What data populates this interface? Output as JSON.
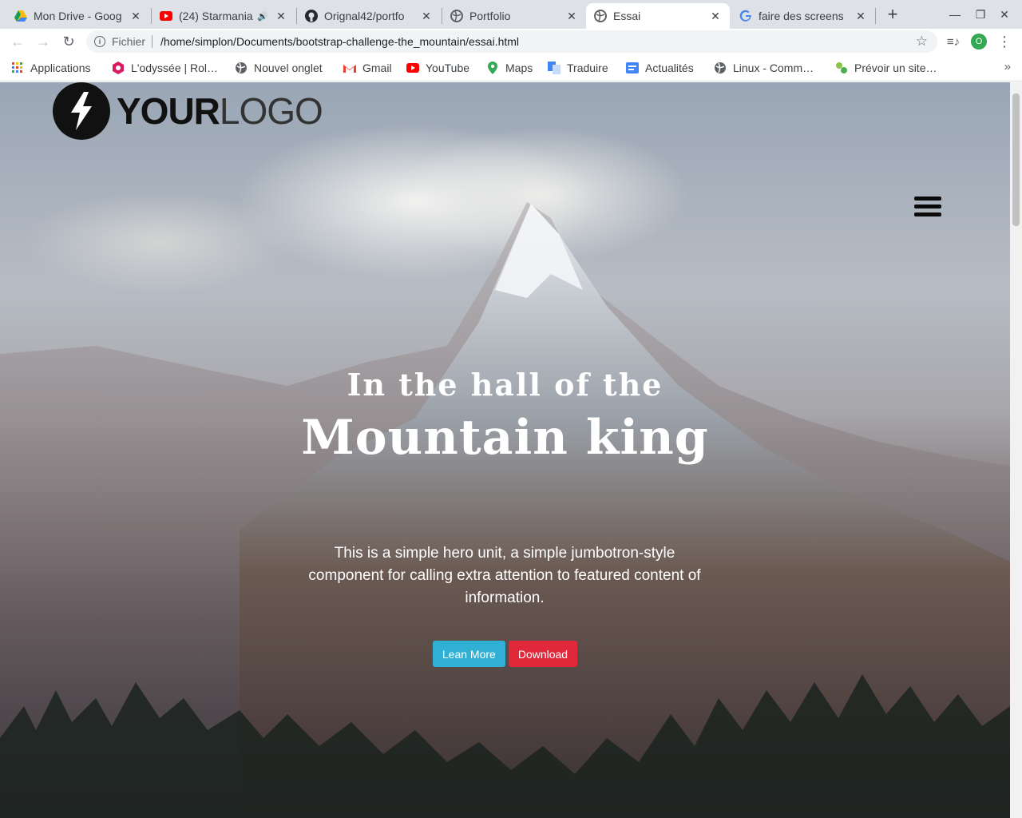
{
  "browser": {
    "tabs": [
      {
        "title": "Mon Drive - Goog",
        "icon": "drive-icon"
      },
      {
        "title": "(24) Starmania",
        "icon": "youtube-icon"
      },
      {
        "title": "Orignal42/portfo",
        "icon": "github-icon"
      },
      {
        "title": "Portfolio",
        "icon": "globe-icon"
      },
      {
        "title": "Essai",
        "icon": "globe-icon"
      },
      {
        "title": "faire des screens",
        "icon": "google-icon"
      }
    ],
    "url_scheme": "Fichier",
    "url": "/home/simplon/Documents/bootstrap-challenge-the_mountain/essai.html",
    "profile_initial": "O"
  },
  "bookmarks": [
    {
      "label": "Applications",
      "icon": "apps-grid-icon"
    },
    {
      "label": "L'odyssée | Rol…",
      "icon": "odyssee-icon"
    },
    {
      "label": "Nouvel onglet",
      "icon": "globe-icon"
    },
    {
      "label": "Gmail",
      "icon": "gmail-icon"
    },
    {
      "label": "YouTube",
      "icon": "youtube-icon"
    },
    {
      "label": "Maps",
      "icon": "maps-icon"
    },
    {
      "label": "Traduire",
      "icon": "translate-icon"
    },
    {
      "label": "Actualités",
      "icon": "news-icon"
    },
    {
      "label": "Linux - Comm…",
      "icon": "globe-icon"
    },
    {
      "label": "Prévoir un site…",
      "icon": "site-icon"
    }
  ],
  "page": {
    "logo_bold": "YOUR",
    "logo_light": "LOGO",
    "kicker": "In the hall of the",
    "title": "Mountain king",
    "description": "This is a simple hero unit, a simple jumbotron-style component for calling extra attention to featured content of information.",
    "button_primary": "Lean More",
    "button_secondary": "Download"
  },
  "colors": {
    "info": "#31b0d5",
    "danger": "#e0283a"
  }
}
